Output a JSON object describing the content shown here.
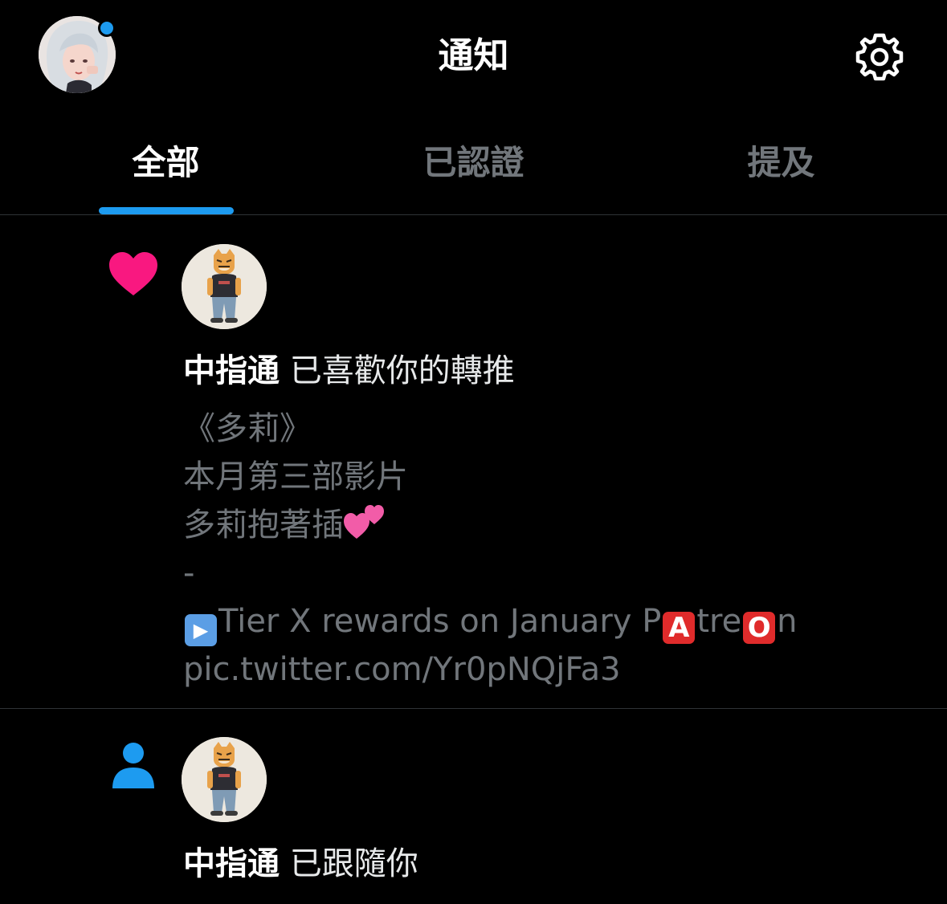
{
  "header": {
    "title": "通知",
    "avatar_icon": "profile-avatar",
    "settings_icon": "gear-icon"
  },
  "tabs": [
    {
      "label": "全部",
      "active": true
    },
    {
      "label": "已認證",
      "active": false
    },
    {
      "label": "提及",
      "active": false
    }
  ],
  "notifications": [
    {
      "type_icon": "heart-icon",
      "user": "中指通",
      "action": "已喜歡你的轉推",
      "preview": {
        "line1": "《多莉》",
        "line2": "本月第三部影片",
        "line3": "多莉抱著插",
        "line3_emoji": "two-hearts-emoji",
        "line4": "-",
        "line5_play_emoji": "play-button-emoji",
        "line5_text_a": "Tier X rewards on January P",
        "line5_letter_a": "A",
        "line5_text_b": "tre",
        "line5_letter_o": "O",
        "line5_text_c": "n",
        "line6": "pic.twitter.com/Yr0pNQjFa3"
      }
    },
    {
      "type_icon": "person-icon",
      "user": "中指通",
      "action": "已跟隨你"
    }
  ],
  "colors": {
    "background": "#000000",
    "accent": "#1d9bf0",
    "heart": "#f91880",
    "muted_text": "#71767b",
    "divider": "#2f3336"
  }
}
